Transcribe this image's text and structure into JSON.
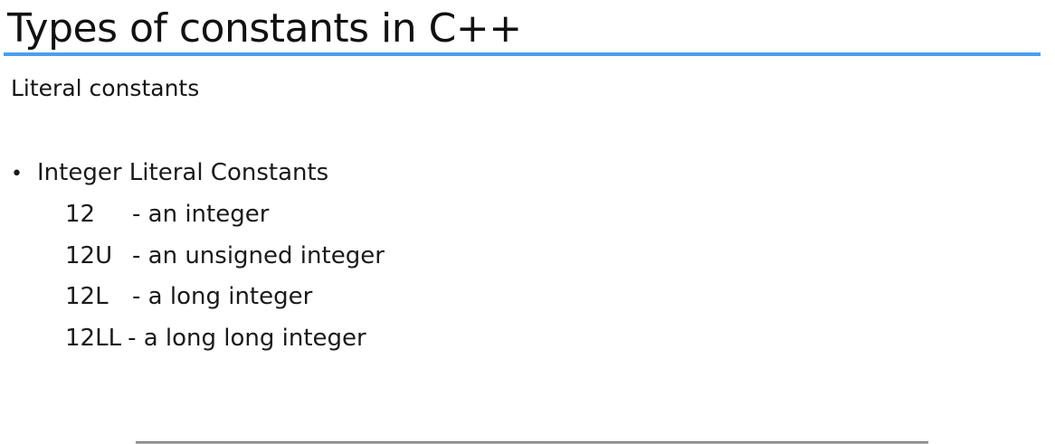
{
  "slide": {
    "title": "Types of constants in C++",
    "subtitle": "Literal constants",
    "bullet": {
      "marker": "•",
      "text": "Integer Literal Constants"
    },
    "items": [
      {
        "code": "12",
        "desc": "- an integer"
      },
      {
        "code": "12U",
        "desc": "- an unsigned integer"
      },
      {
        "code": "12L",
        "desc": "- a long integer"
      },
      {
        "code": "12LL",
        "desc": "- a long long integer"
      }
    ]
  },
  "colors": {
    "title_rule": "#4a9ff0",
    "text": "#1a1a1a",
    "background": "#ffffff"
  }
}
